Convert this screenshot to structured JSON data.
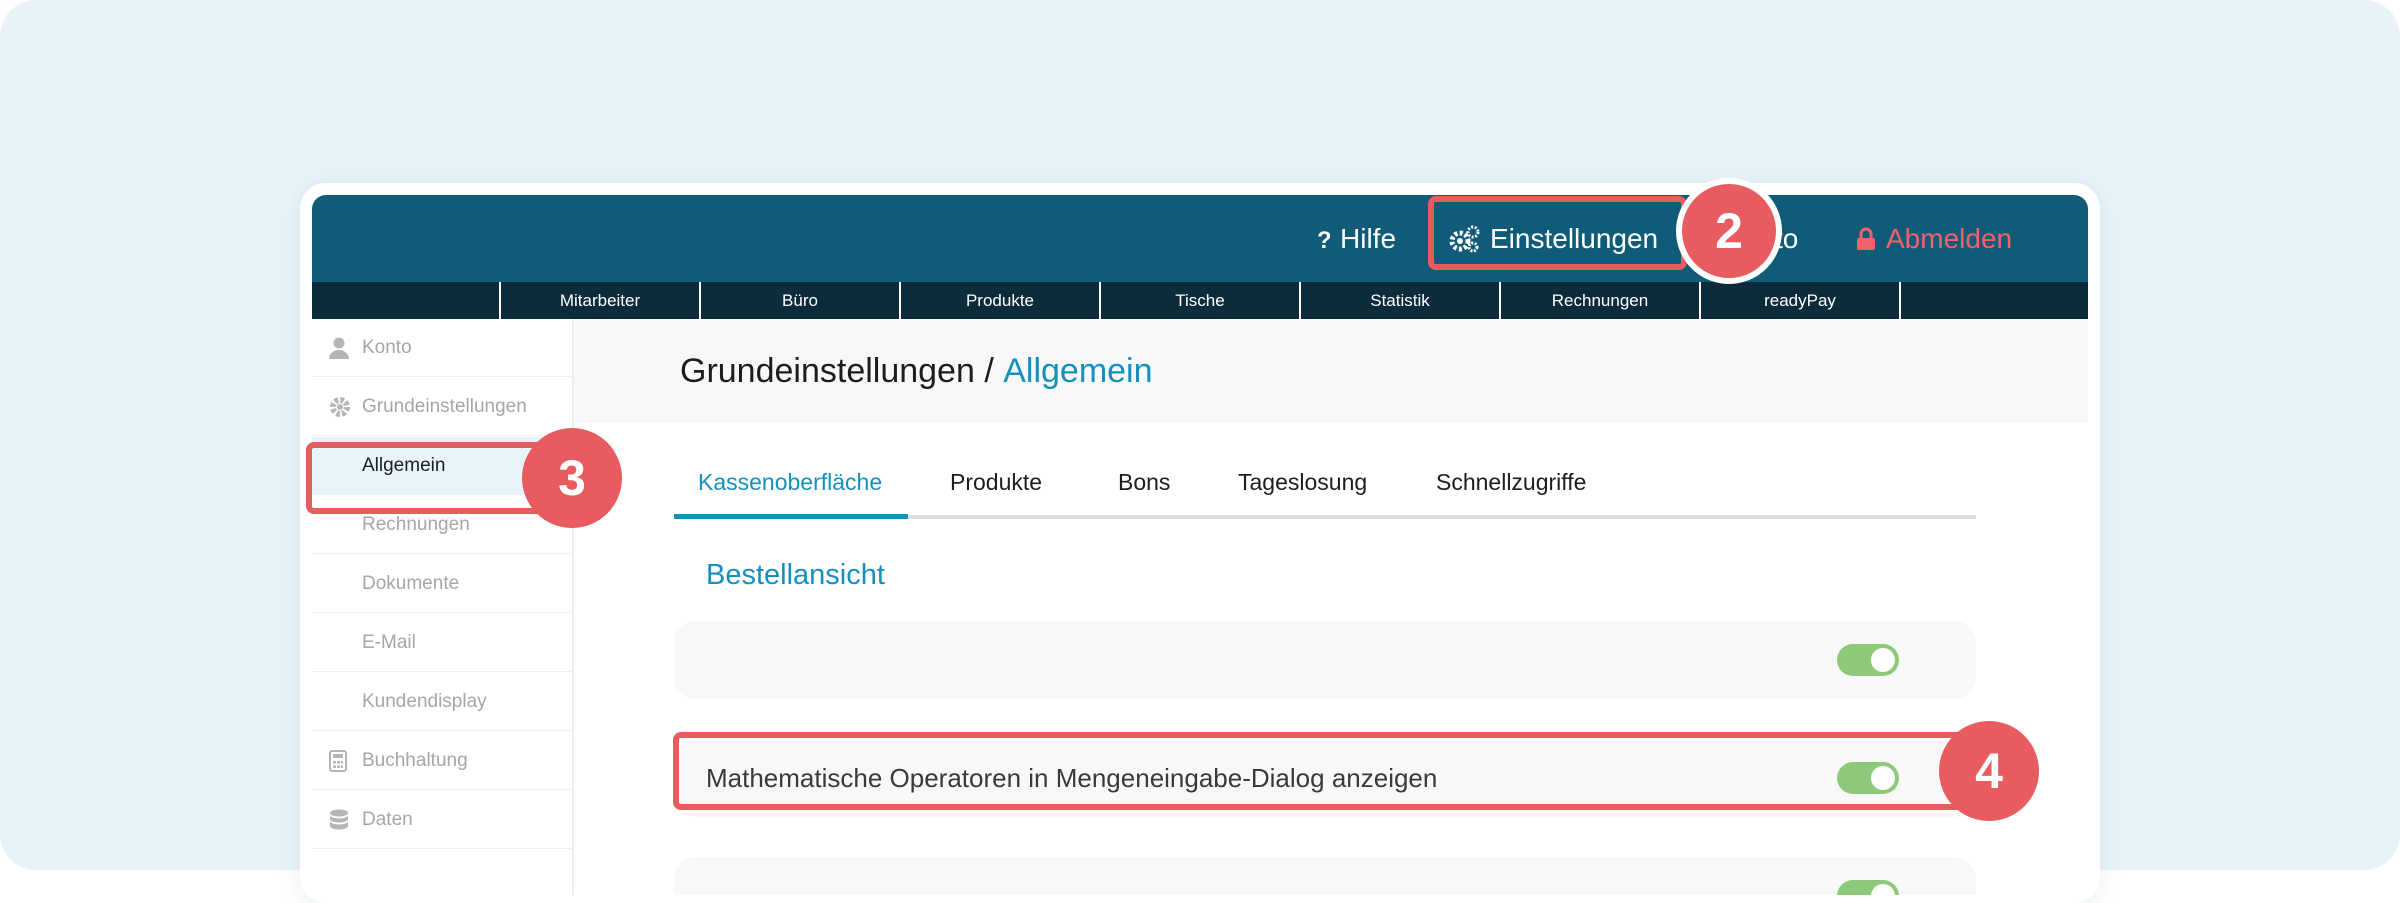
{
  "colors": {
    "topbar": "#0f5b78",
    "subnav": "#0d2c3b",
    "accent": "#1590bd",
    "logout": "#f2626a",
    "highlight": "#e85b5e",
    "toggle_on": "#8dc97a"
  },
  "topbar": {
    "help": {
      "label": "Hilfe",
      "icon": "question-icon"
    },
    "settings": {
      "label": "Einstellungen",
      "icon": "gears-icon"
    },
    "account_partial": "to",
    "logout": {
      "label": "Abmelden",
      "icon": "lock-icon"
    }
  },
  "subnav": [
    "Mitarbeiter",
    "Büro",
    "Produkte",
    "Tische",
    "Statistik",
    "Rechnungen",
    "readyPay"
  ],
  "sidebar": {
    "items": [
      {
        "label": "Konto",
        "icon": "user-icon"
      },
      {
        "label": "Grundeinstellungen",
        "icon": "gear-icon"
      },
      {
        "label": "Allgemein"
      },
      {
        "label": "Rechnungen"
      },
      {
        "label": "Dokumente"
      },
      {
        "label": "E-Mail"
      },
      {
        "label": "Kundendisplay"
      },
      {
        "label": "Buchhaltung",
        "icon": "calculator-icon"
      },
      {
        "label": "Daten",
        "icon": "database-icon"
      }
    ]
  },
  "page": {
    "title_prefix": "Grundeinstellungen / ",
    "title_accent": "Allgemein"
  },
  "tabs": [
    "Kassenoberfläche",
    "Produkte",
    "Bons",
    "Tageslosung",
    "Schnellzugriffe"
  ],
  "section": {
    "title": "Bestellansicht"
  },
  "rows": [
    {
      "label": "",
      "toggle": true
    },
    {
      "label": "Mathematische Operatoren in Mengeneingabe-Dialog anzeigen",
      "toggle": true
    },
    {
      "label": "",
      "toggle": true
    }
  ],
  "badges": [
    "2",
    "3",
    "4"
  ]
}
